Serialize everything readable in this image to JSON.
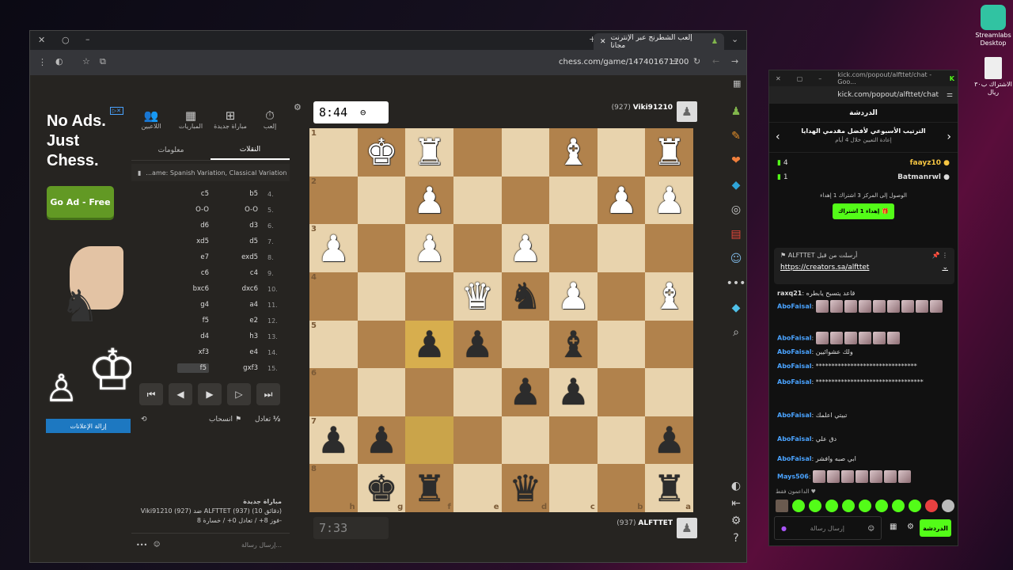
{
  "desktop": {
    "streamlabs_label": "Streamlabs Desktop",
    "file_label": "الاشتراك ب٣٠ ريال"
  },
  "browser": {
    "tab_title": "إلعب الشطرنج عبر الإنترنت مجانا",
    "url": "chess.com/game/147401671700"
  },
  "ad": {
    "headline_1": "No Ads.",
    "headline_2": "Just",
    "headline_3": "Chess.",
    "cta": "Go Ad - Free",
    "remove": "إزالة الإعلانات"
  },
  "panel": {
    "tabs": [
      {
        "label": "إلعب",
        "icon": "⏱"
      },
      {
        "label": "مباراة جديدة",
        "icon": "⊞"
      },
      {
        "label": "المباريات",
        "icon": "▦"
      },
      {
        "label": "اللاعبين",
        "icon": "👥"
      }
    ],
    "subtab_moves": "النقلات",
    "subtab_info": "معلومات",
    "opening": "...ame: Spanish Variation, Classical Variation",
    "moves": [
      {
        "n": "4.",
        "w": "b5",
        "b": "c5"
      },
      {
        "n": "5.",
        "w": "O-O",
        "b": "O-O"
      },
      {
        "n": "6.",
        "w": "d3",
        "b": "d6"
      },
      {
        "n": "7.",
        "w": "d5",
        "b": "xd5"
      },
      {
        "n": "8.",
        "w": "exd5",
        "b": "e7"
      },
      {
        "n": "9.",
        "w": "c4",
        "b": "c6"
      },
      {
        "n": "10.",
        "w": "dxc6",
        "b": "bxc6"
      },
      {
        "n": "11.",
        "w": "a4",
        "b": "g4"
      },
      {
        "n": "12.",
        "w": "e2",
        "b": "f5"
      },
      {
        "n": "13.",
        "w": "h3",
        "b": "d4"
      },
      {
        "n": "14.",
        "w": "e4",
        "b": "xf3"
      },
      {
        "n": "15.",
        "w": "gxf3",
        "b": "f5"
      }
    ],
    "draw": "تعادل",
    "resign": "انسحاب",
    "half": "½",
    "new_game_title": "مباراة جديدة",
    "game_line": "Viki91210 (927) ضد ALFTTET (937) (10 دقائق)",
    "score_line": "فوز 8+ / تعادل 0+ / خسارة 8-",
    "chat_placeholder": "إرسال رسالة..."
  },
  "game": {
    "top_clock": "8:44",
    "bottom_clock": "7:33",
    "top_player": "Viki91210",
    "top_rating": "(927)",
    "bottom_player": "ALFTTET",
    "bottom_rating": "(937)",
    "ranks": [
      "1",
      "2",
      "3",
      "4",
      "5",
      "6",
      "7",
      "8"
    ],
    "files": [
      "h",
      "g",
      "f",
      "e",
      "d",
      "c",
      "b",
      "a"
    ],
    "board": [
      [
        "",
        "wK",
        "wR",
        "",
        "",
        "wB",
        "",
        "wR"
      ],
      [
        "",
        "",
        "wP",
        "",
        "",
        "",
        "wP",
        "wP"
      ],
      [
        "wP",
        "",
        "wP",
        "",
        "wP",
        "",
        "",
        ""
      ],
      [
        "",
        "",
        "",
        "wQ",
        "bN",
        "wP",
        "",
        "wB"
      ],
      [
        "",
        "",
        "bP",
        "bP",
        "",
        "bB",
        "",
        ""
      ],
      [
        "",
        "",
        "",
        "",
        "bP",
        "bP",
        "",
        ""
      ],
      [
        "bP",
        "bP",
        "",
        "",
        "",
        "",
        "",
        "bP"
      ],
      [
        "",
        "bK",
        "bR",
        "",
        "bQ",
        "",
        "",
        "bR"
      ]
    ]
  },
  "kick": {
    "window_url": "kick.com/popout/alfttet/chat - Goo...",
    "address": "kick.com/popout/alfttet/chat",
    "header": "الدردشة",
    "goal_title": "الترتيب الأسبوعي لأفضل مقدمي الهدايا",
    "goal_sub": "إعادة التعيين خلال 4 أيام",
    "leader1_name": "faayz10",
    "leader1_count": "4",
    "leader2_name": "Batmanrwl",
    "leader2_count": "1",
    "promo": "الوصول إلى المركز 3 اشتراك 1 إهداء",
    "gift_button": "إهداء 1 اشتراك",
    "pin_by": "ALFTTET أرسلت من قبل",
    "pin_link": "https://creators.sa/alfttet",
    "messages": [
      {
        "user": "raxq21",
        "text": "قاعد يتسبح يابطره"
      },
      {
        "user": "AboFaisal",
        "text": ""
      },
      {
        "user": "AboFaisal",
        "text": ""
      },
      {
        "user": "AboFaisal",
        "text": "ولك عشوائيين"
      },
      {
        "user": "AboFaisal",
        "text": "********************************"
      },
      {
        "user": "AboFaisal",
        "text": "**********************************"
      },
      {
        "user": "AboFaisal",
        "text": "تبيتي اعلمك"
      },
      {
        "user": "AboFaisal",
        "text": "دق علي"
      },
      {
        "user": "AboFaisal",
        "text": "ابي صبه وافشر"
      },
      {
        "user": "Mays506",
        "text": ""
      }
    ],
    "supporters_label": "الداعمون فقط",
    "input_placeholder": "إرسال رسالة",
    "send": "الدردشة"
  }
}
